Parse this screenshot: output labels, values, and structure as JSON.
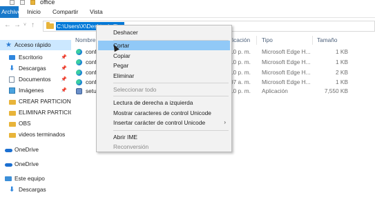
{
  "window": {
    "title": "office"
  },
  "ribbon": {
    "tabs": [
      "Archivo",
      "Inicio",
      "Compartir",
      "Vista"
    ]
  },
  "address": {
    "path": "C:\\Users\\X\\Desktop\\office"
  },
  "nav": {
    "items": [
      {
        "label": "Acceso rápido",
        "icon": "star-icon",
        "pinned": false
      },
      {
        "label": "Escritorio",
        "icon": "desktop-icon",
        "pinned": true
      },
      {
        "label": "Descargas",
        "icon": "download-icon",
        "pinned": true
      },
      {
        "label": "Documentos",
        "icon": "document-icon",
        "pinned": true
      },
      {
        "label": "Imágenes",
        "icon": "image-icon",
        "pinned": true
      },
      {
        "label": "CREAR PARTICIONE",
        "icon": "folder-icon",
        "pinned": false
      },
      {
        "label": "ELIMINAR PARTICIC",
        "icon": "folder-icon",
        "pinned": false
      },
      {
        "label": "OBS",
        "icon": "folder-icon",
        "pinned": false
      },
      {
        "label": "videos terminados",
        "icon": "folder-icon",
        "pinned": false
      },
      {
        "label": "OneDrive",
        "icon": "onedrive-icon",
        "pinned": false
      },
      {
        "label": "OneDrive",
        "icon": "onedrive-icon",
        "pinned": false
      },
      {
        "label": "Este equipo",
        "icon": "computer-icon",
        "pinned": false
      },
      {
        "label": "Descargas",
        "icon": "download-icon",
        "pinned": false
      }
    ]
  },
  "list": {
    "headers": {
      "name": "Nombre",
      "date": "ficación",
      "type": "Tipo",
      "size": "Tamaño"
    },
    "rows": [
      {
        "name": "conf",
        "date": "10 p. m.",
        "type": "Microsoft Edge H...",
        "size": "1 KB",
        "icon": "edge-icon"
      },
      {
        "name": "conf",
        "date": "10 p. m.",
        "type": "Microsoft Edge H...",
        "size": "1 KB",
        "icon": "edge-icon"
      },
      {
        "name": "conf",
        "date": "10 p. m.",
        "type": "Microsoft Edge H...",
        "size": "2 KB",
        "icon": "edge-icon"
      },
      {
        "name": "conf",
        "date": "07 a. m.",
        "type": "Microsoft Edge H...",
        "size": "1 KB",
        "icon": "edge-icon"
      },
      {
        "name": "setup",
        "date": "10 p. m.",
        "type": "Aplicación",
        "size": "7,550 KB",
        "icon": "setup-icon"
      }
    ]
  },
  "context_menu": {
    "items": [
      {
        "label": "Deshacer",
        "disabled": false
      },
      {
        "label": "Cortar",
        "disabled": false,
        "highlighted": true
      },
      {
        "label": "Copiar",
        "disabled": false
      },
      {
        "label": "Pegar",
        "disabled": false
      },
      {
        "label": "Eliminar",
        "disabled": false
      },
      {
        "label": "Seleccionar todo",
        "disabled": true
      },
      {
        "label": "Lectura de derecha a izquierda",
        "disabled": false
      },
      {
        "label": "Mostrar caracteres de control Unicode",
        "disabled": false
      },
      {
        "label": "Insertar carácter de control Unicode",
        "disabled": false,
        "submenu": true
      },
      {
        "label": "Abrir IME",
        "disabled": false
      },
      {
        "label": "Reconversión",
        "disabled": true
      }
    ],
    "submenu_arrow": "›"
  },
  "colors": {
    "accent": "#0078d7",
    "file_tab": "#1979ca",
    "nav_selected": "#cce8ff",
    "menu_highlight": "#91c9f7"
  }
}
